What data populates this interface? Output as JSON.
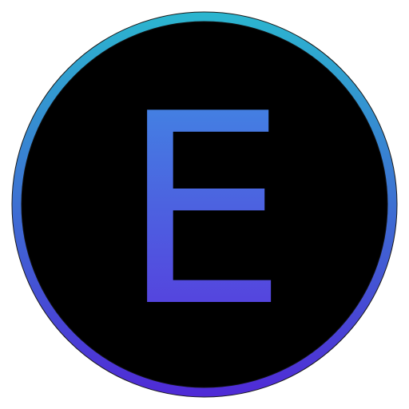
{
  "logo": {
    "letter": "E",
    "colors": {
      "gradient_top": "#2bb6cf",
      "gradient_bottom": "#4f2ad6",
      "letter_top": "#3f8fe3",
      "letter_bottom": "#5a32dd",
      "fill": "#000000",
      "background": "#ffffff"
    }
  }
}
